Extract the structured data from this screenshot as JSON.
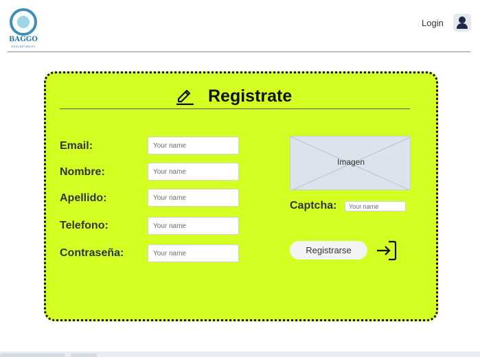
{
  "header": {
    "logo": {
      "name": "BAGGO",
      "subtitle": "DESCARTABLES"
    },
    "login_label": "Login",
    "user_icon": "user-icon"
  },
  "form": {
    "title": "Registrate",
    "title_icon": "pencil-icon",
    "fields": [
      {
        "label": "Email:",
        "placeholder": "Your name"
      },
      {
        "label": "Nombre:",
        "placeholder": "Your name"
      },
      {
        "label": "Apellido:",
        "placeholder": "Your name"
      },
      {
        "label": "Telefono:",
        "placeholder": "Your name"
      },
      {
        "label": "Contraseña:",
        "placeholder": "Your name"
      }
    ],
    "image_label": "Imagen",
    "captcha": {
      "label": "Captcha:",
      "placeholder": "Your name"
    },
    "submit_label": "Registrarse",
    "submit_icon": "enter-icon"
  },
  "colors": {
    "card_background": "#d3ff22",
    "logo_blue": "#3d8fb5",
    "user_icon": "#1c2a45"
  }
}
